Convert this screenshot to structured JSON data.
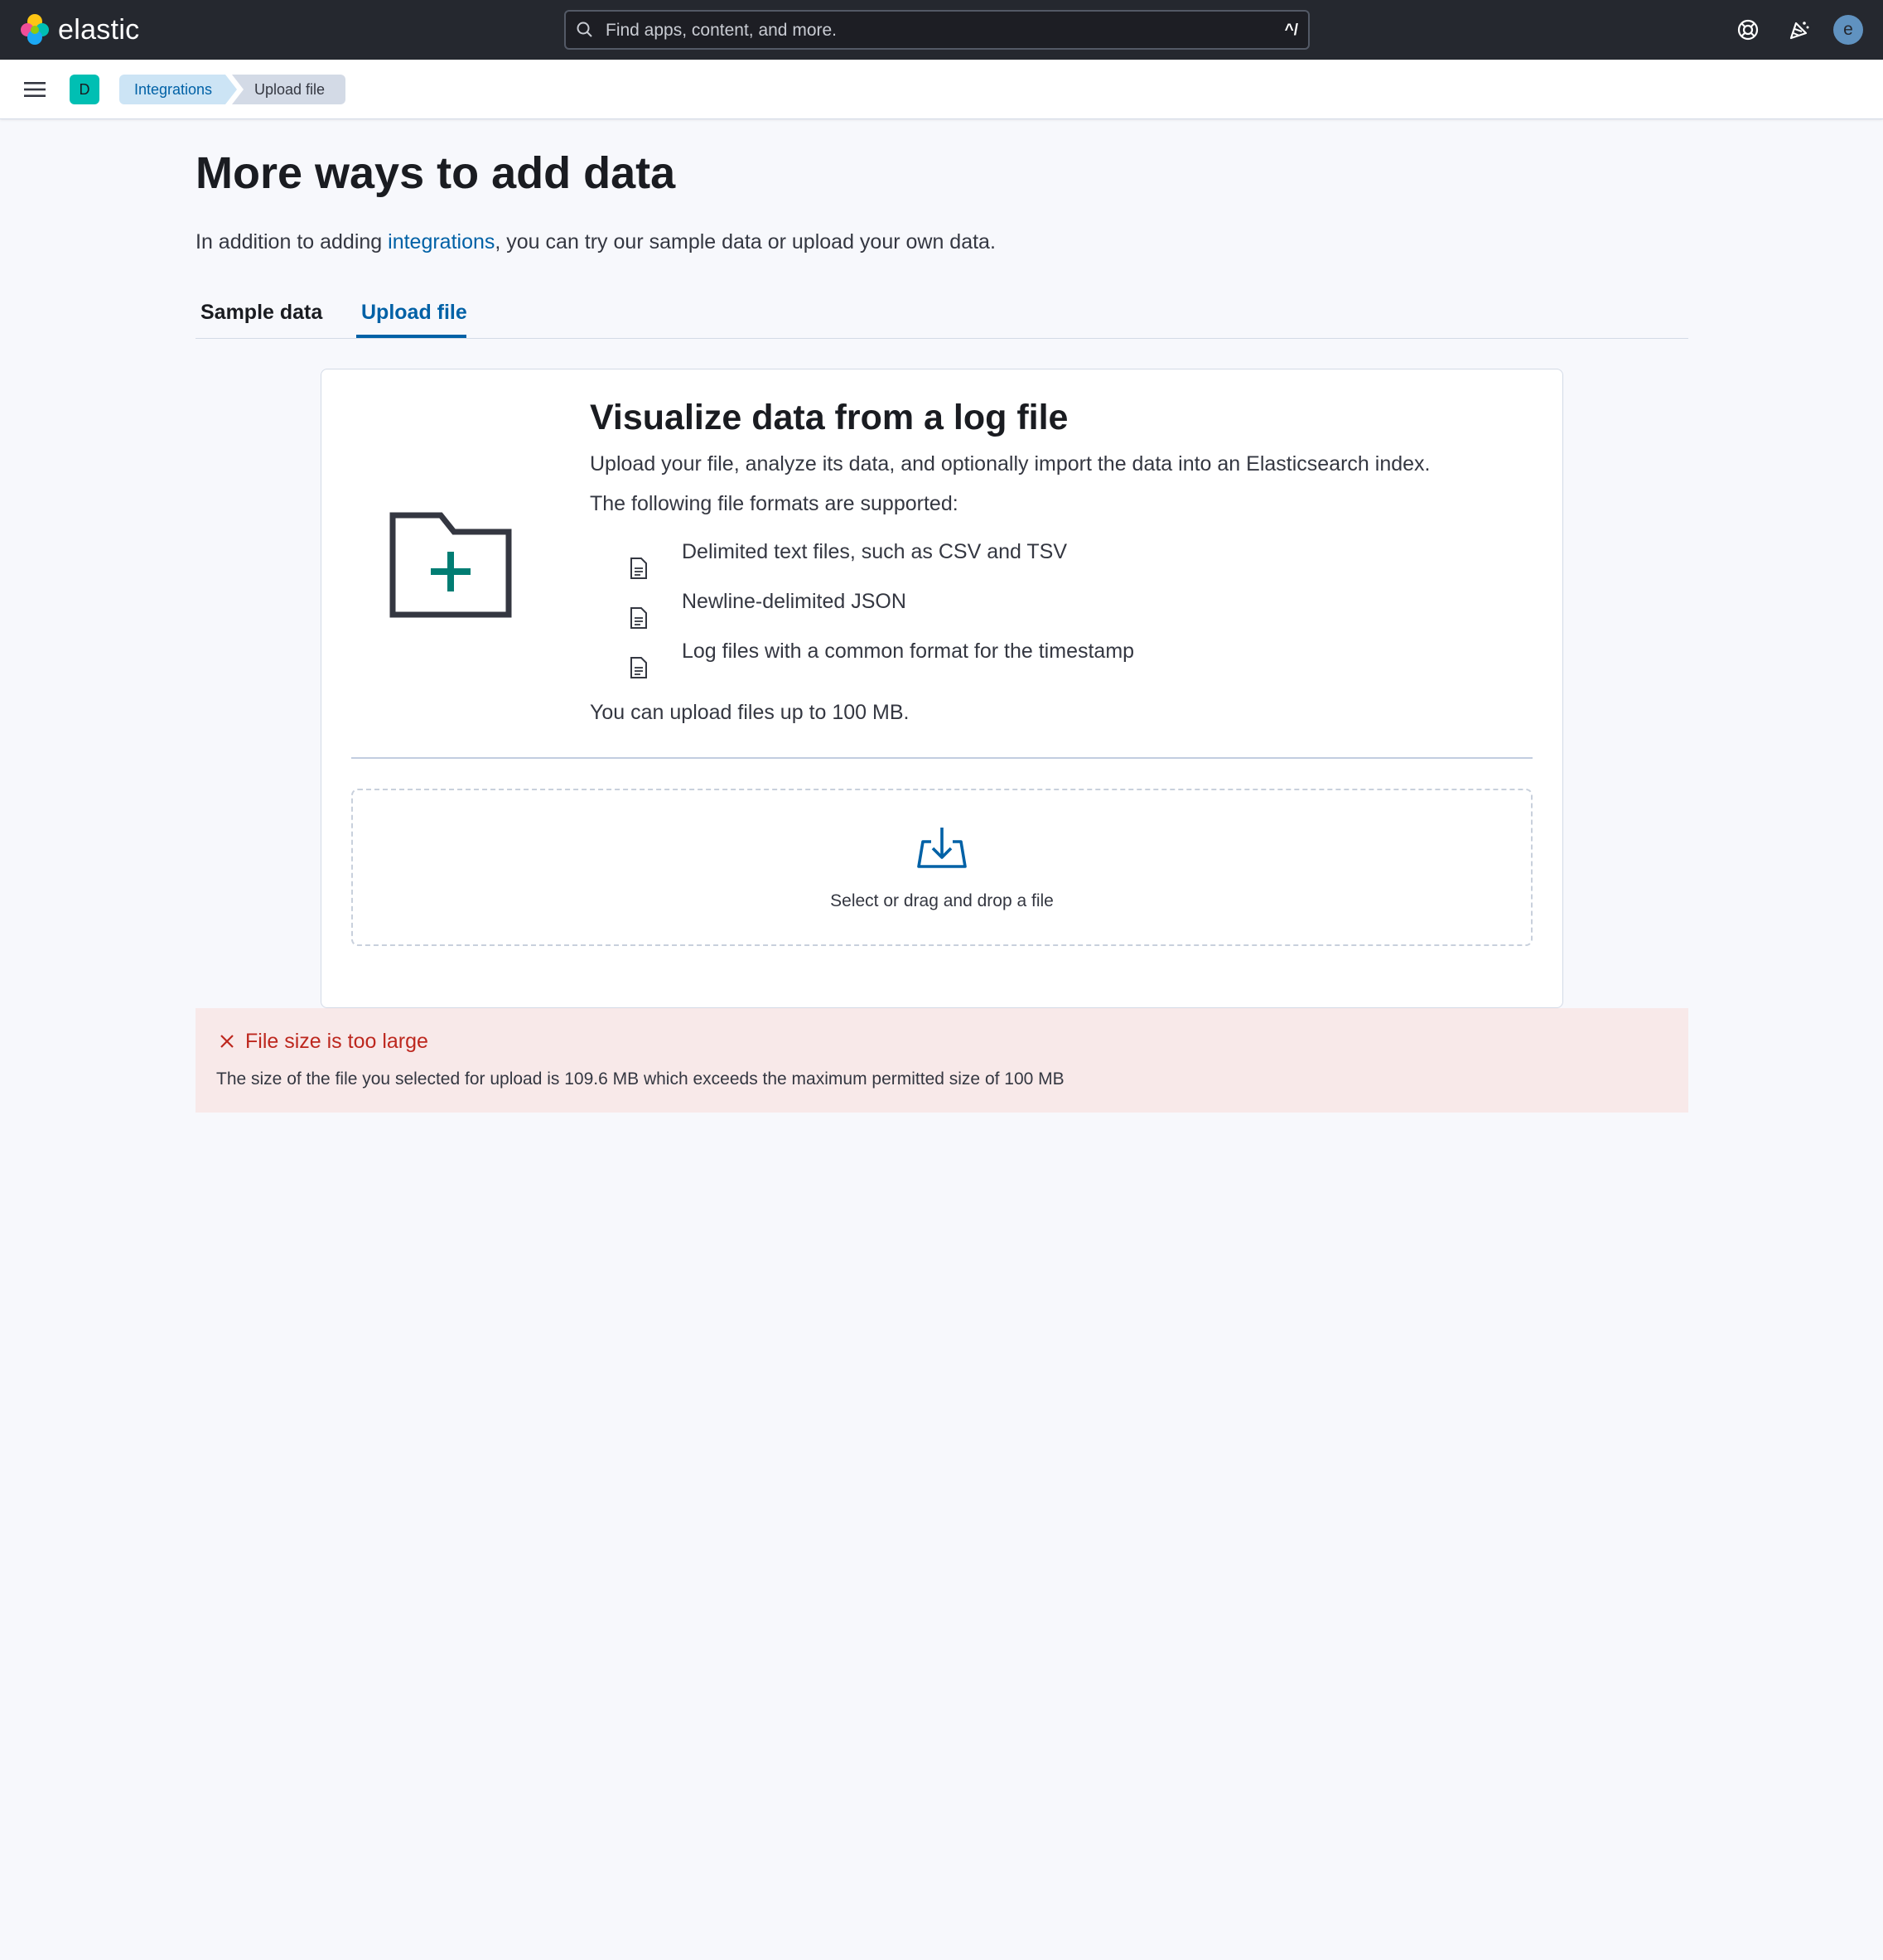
{
  "header": {
    "brand": "elastic",
    "search_placeholder": "Find apps, content, and more.",
    "search_shortcut": "^/",
    "avatar_initial": "e",
    "icons": [
      "help-icon",
      "newsfeed-icon"
    ]
  },
  "subheader": {
    "space_initial": "D",
    "breadcrumbs": [
      "Integrations",
      "Upload file"
    ]
  },
  "page": {
    "title": "More ways to add data",
    "intro_before": "In addition to adding ",
    "intro_link": "integrations",
    "intro_after": ", you can try our sample data or upload your own data.",
    "tabs": [
      {
        "label": "Sample data",
        "selected": false
      },
      {
        "label": "Upload file",
        "selected": true
      }
    ]
  },
  "upload_panel": {
    "title": "Visualize data from a log file",
    "description": "Upload your file, analyze its data, and optionally import the data into an Elasticsearch index.",
    "formats_label": "The following file formats are supported:",
    "formats": [
      "Delimited text files, such as CSV and TSV",
      "Newline-delimited JSON",
      "Log files with a common format for the timestamp"
    ],
    "limit_text": "You can upload files up to 100 MB.",
    "dropzone_text": "Select or drag and drop a file"
  },
  "error": {
    "title": "File size is too large",
    "message": "The size of the file you selected for upload is 109.6 MB which exceeds the maximum permitted size of 100 MB"
  },
  "colors": {
    "header_bg": "#25282f",
    "accent": "#0061a6",
    "error": "#bd271e",
    "error_bg": "#f8e9e9",
    "teal": "#00bfb3"
  }
}
